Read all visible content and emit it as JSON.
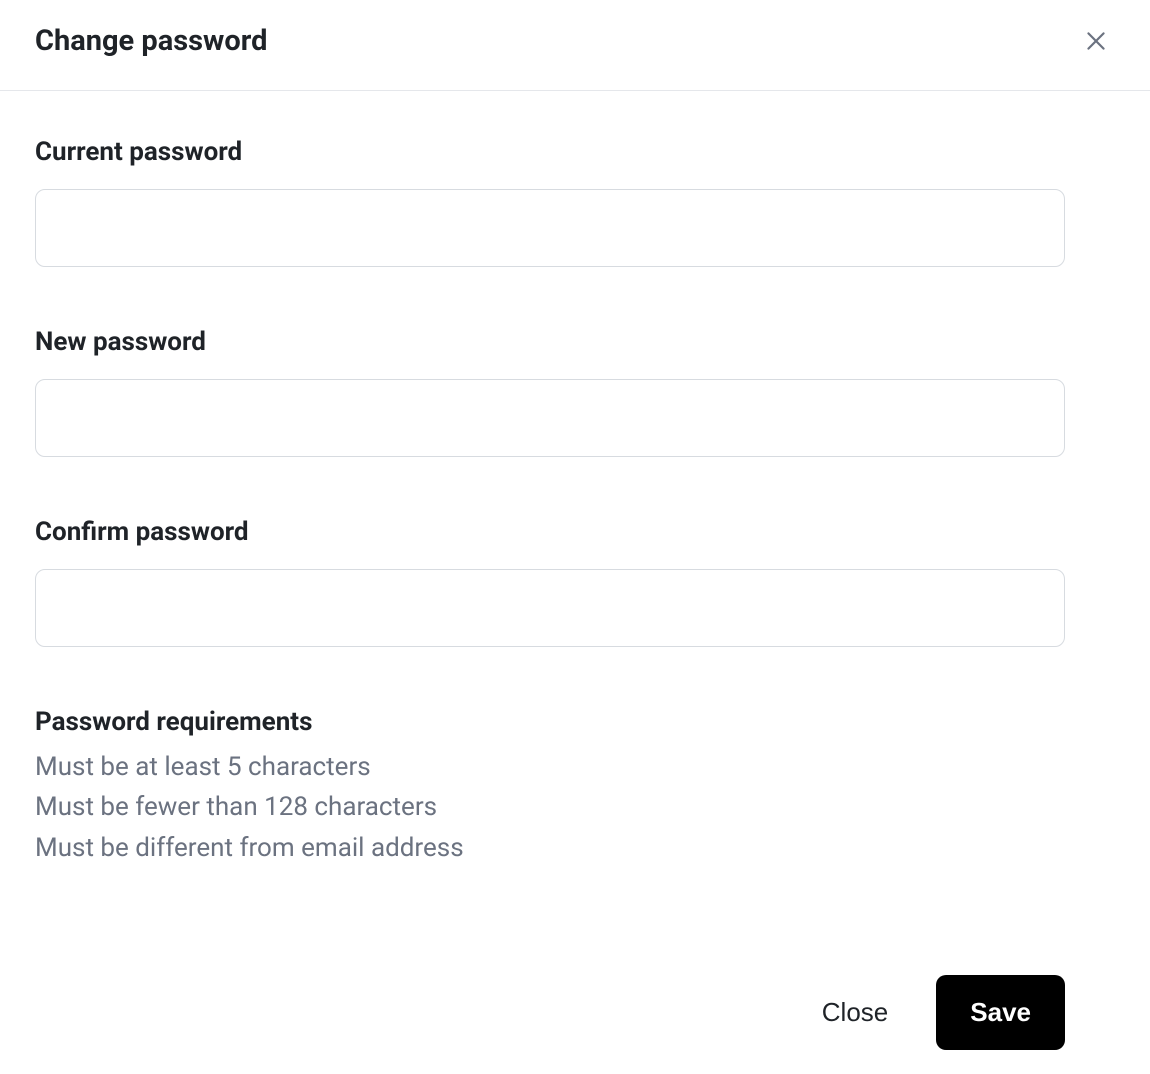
{
  "header": {
    "title": "Change password"
  },
  "fields": {
    "current": {
      "label": "Current password",
      "value": ""
    },
    "new": {
      "label": "New password",
      "value": ""
    },
    "confirm": {
      "label": "Confirm password",
      "value": ""
    }
  },
  "requirements": {
    "title": "Password requirements",
    "items": [
      "Must be at least 5 characters",
      "Must be fewer than 128 characters",
      "Must be different from email address"
    ]
  },
  "footer": {
    "close_label": "Close",
    "save_label": "Save"
  }
}
